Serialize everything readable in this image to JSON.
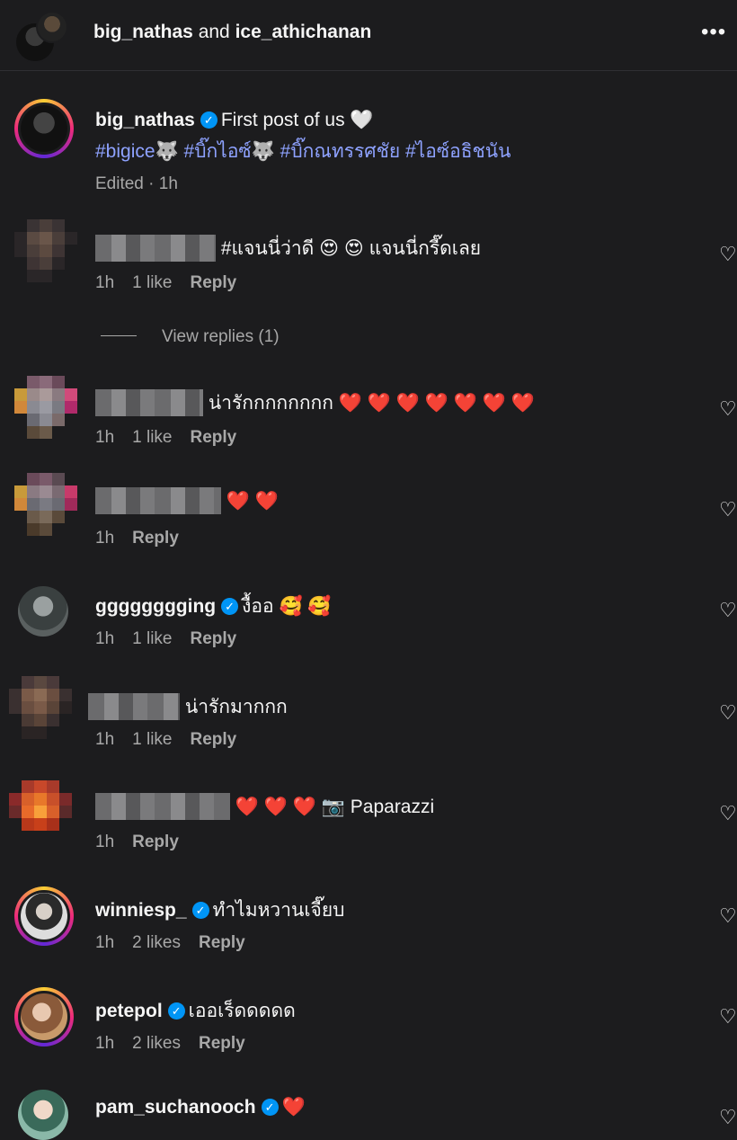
{
  "header": {
    "user1": "big_nathas",
    "and_text": " and ",
    "user2": "ice_athichanan",
    "more_icon": "more-horizontal-icon"
  },
  "caption": {
    "username": "big_nathas",
    "text": "First post of us 🤍",
    "hashtags": "#bigice🐺 #บิ๊กไอซ์🐺 #บิ๊กณทรรศชัย #ไอซ์อธิชนัน",
    "meta": "Edited · 1h"
  },
  "comments": [
    {
      "username": "",
      "text": "#แจนนี่ว่าดี 😍 😍 แจนนี่กรี๊ดเลย",
      "time": "1h",
      "likes": "1 like",
      "reply": "Reply",
      "view_replies": "View replies (1)"
    },
    {
      "username": "",
      "text": "น่ารักกกกกกกก ❤️ ❤️ ❤️ ❤️ ❤️ ❤️ ❤️",
      "time": "1h",
      "likes": "1 like",
      "reply": "Reply"
    },
    {
      "username": "",
      "text": "❤️ ❤️",
      "time": "1h",
      "likes": "",
      "reply": "Reply"
    },
    {
      "username": "gggggggging",
      "verified": true,
      "text": "งื้ออ 🥰 🥰",
      "time": "1h",
      "likes": "1 like",
      "reply": "Reply"
    },
    {
      "username": "",
      "text": "น่ารักมากกก",
      "time": "1h",
      "likes": "1 like",
      "reply": "Reply"
    },
    {
      "username": "",
      "text": "❤️ ❤️ ❤️ 📷 Paparazzi",
      "time": "1h",
      "likes": "",
      "reply": "Reply"
    },
    {
      "username": "winniesp_",
      "verified": true,
      "text": "ทำไมหวานเจี๊ยบ",
      "time": "1h",
      "likes": "2 likes",
      "reply": "Reply"
    },
    {
      "username": "petepol",
      "verified": true,
      "text": "เออเร็ดดดดด",
      "time": "1h",
      "likes": "2 likes",
      "reply": "Reply"
    },
    {
      "username": "pam_suchanooch",
      "verified": true,
      "text": "❤️",
      "time": "",
      "likes": "",
      "reply": ""
    }
  ],
  "verified_icon": "verified-badge-icon",
  "like_icon": "heart-outline-icon"
}
